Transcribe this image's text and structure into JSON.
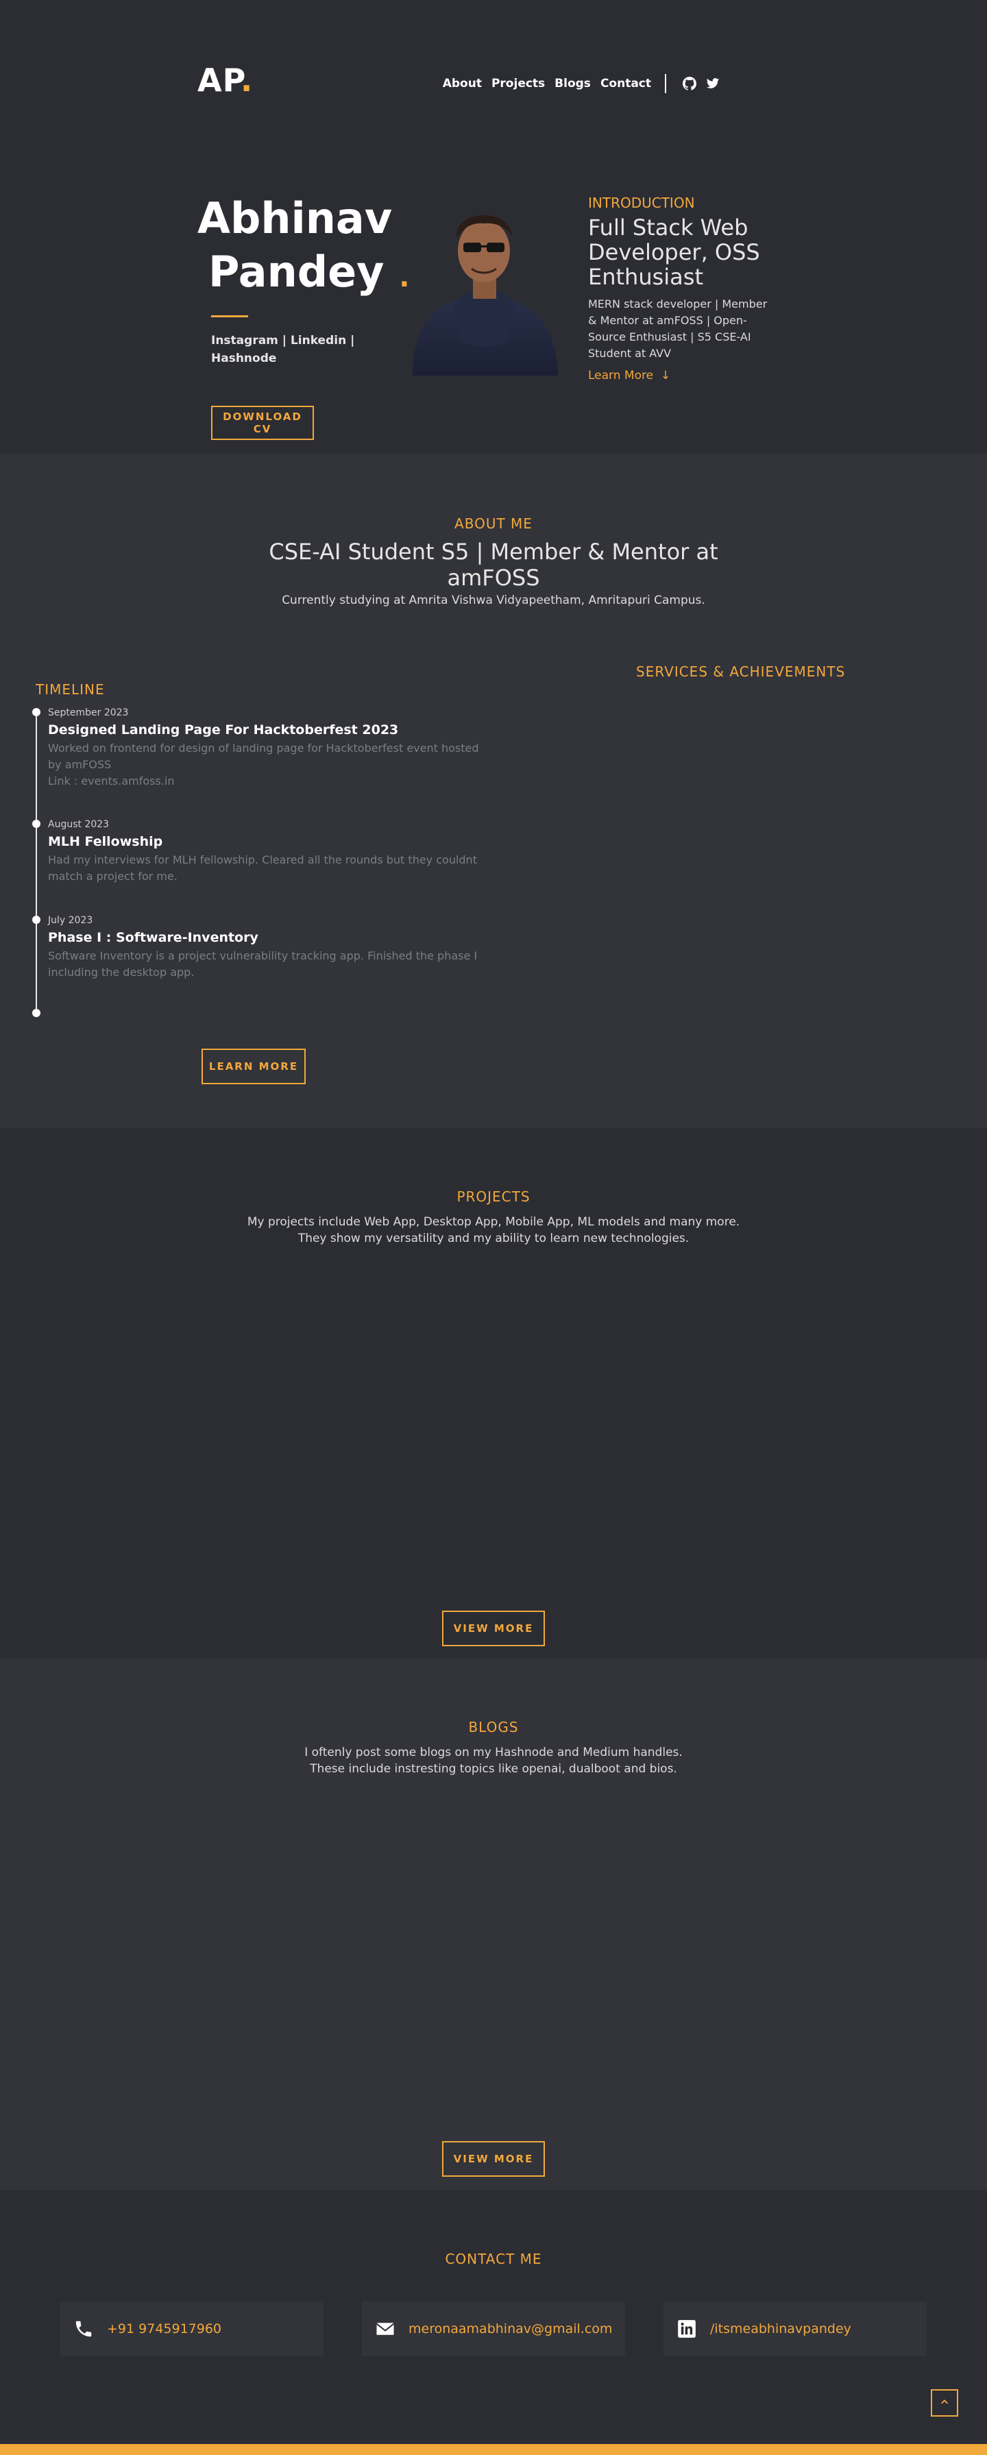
{
  "header": {
    "logo": "AP",
    "logo_dot": ".",
    "nav": [
      "About",
      "Projects",
      "Blogs",
      "Contact"
    ],
    "icons": [
      "github-icon",
      "twitter-icon"
    ]
  },
  "hero": {
    "name_line1": "Abhinav",
    "name_line2": "Pandey",
    "name_dot": ".",
    "socials": "Instagram  |  Linkedin  |  Hashnode",
    "download_cv": "DOWNLOAD CV",
    "intro_label": "INTRODUCTION",
    "intro_title": "Full Stack Web Developer, OSS Enthusiast",
    "intro_desc": "MERN stack developer | Member & Mentor at amFOSS | Open-Source Enthusiast | S5 CSE-AI Student at AVV",
    "learn_more": "Learn More",
    "learn_more_arrow": "↓"
  },
  "about": {
    "label": "ABOUT ME",
    "title_line1": "CSE-AI Student S5 | Member & Mentor at",
    "title_line2": "amFOSS",
    "subtitle": "Currently studying at Amrita Vishwa Vidyapeetham, Amritapuri Campus.",
    "timeline_label": "TIMELINE",
    "services_label": "SERVICES & ACHIEVEMENTS",
    "timeline": [
      {
        "date": "September 2023",
        "title": "Designed Landing Page For Hacktoberfest 2023",
        "desc": "Worked on frontend for design of landing page for Hacktoberfest event hosted by amFOSS",
        "link": "Link :  events.amfoss.in"
      },
      {
        "date": "August 2023",
        "title": "MLH Fellowship",
        "desc": "Had my interviews for MLH fellowship. Cleared all the rounds but they couldnt match a project for me."
      },
      {
        "date": "July 2023",
        "title": "Phase I : Software-Inventory",
        "desc": "Software Inventory is a project vulnerability tracking app. Finished the phase I including the desktop app."
      }
    ],
    "learn_more_button": "LEARN MORE"
  },
  "projects": {
    "label": "PROJECTS",
    "desc_line1": "My projects include Web App, Desktop App, Mobile App, ML models and many more.",
    "desc_line2": "They show my versatility and my ability to learn new technologies.",
    "button": "VIEW MORE"
  },
  "blogs": {
    "label": "BLOGS",
    "desc_line1": "I oftenly post some blogs on my Hashnode and Medium handles.",
    "desc_line2": "These include instresting topics like openai, dualboot and bios.",
    "button": "VIEW MORE"
  },
  "contact": {
    "label": "CONTACT ME",
    "phone": "+91 9745917960",
    "email": "meronaamabhinav@gmail.com",
    "linkedin": "/itsmeabhinavpandey"
  },
  "colors": {
    "accent": "#f2a93b",
    "bg_dark": "#2c2c33",
    "bg_light": "#33333a"
  }
}
